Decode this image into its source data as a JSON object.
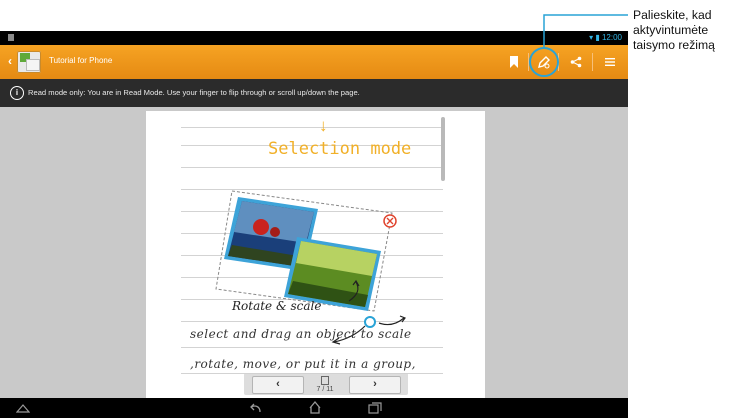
{
  "status_bar": {
    "time": "12:00"
  },
  "action_bar": {
    "back": "‹",
    "title": "Tutorial for Phone"
  },
  "notice": {
    "info_symbol": "i",
    "text": "Read mode only: You are in Read Mode. Use your finger to flip through or scroll up/down the page."
  },
  "page": {
    "heading": "Selection mode",
    "label": "Rotate & scale",
    "line1": "select and drag an object to scale",
    "line2": ",rotate, move, or put it in a group,"
  },
  "pager": {
    "prev": "‹",
    "next": "›",
    "current": "7",
    "total": "11",
    "separator": "/"
  },
  "callout": {
    "line1": "Palieskite, kad",
    "line2": "aktyvintumėte",
    "line3": "taisymo režimą"
  },
  "colors": {
    "action_bar": "#f39c1c",
    "accent": "#29a3d6",
    "heading": "#f1b028"
  },
  "icons": [
    "bookmark-icon",
    "edit-mode-icon",
    "share-icon",
    "menu-icon",
    "home-icon",
    "back-nav-icon",
    "recent-apps-icon"
  ]
}
